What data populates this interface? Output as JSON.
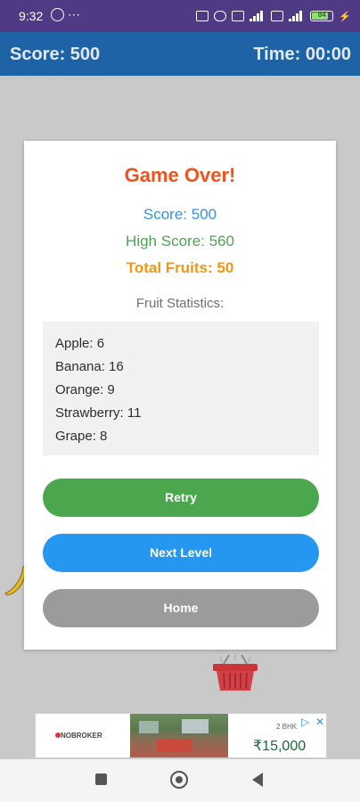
{
  "status_bar": {
    "time": "9:32",
    "dots": "⋯",
    "battery_level": "84",
    "bolt": "⚡"
  },
  "hud": {
    "score": "Score: 500",
    "time": "Time: 00:00"
  },
  "dialog": {
    "title": "Game Over!",
    "score_line": "Score: 500",
    "high_score_line": "High Score: 560",
    "total_fruits_line": "Total Fruits: 50",
    "stats_title": "Fruit Statistics:",
    "fruit_stats": [
      "Apple: 6",
      "Banana: 16",
      "Orange: 9",
      "Strawberry: 11",
      "Grape: 8"
    ],
    "buttons": {
      "retry": "Retry",
      "next_level": "Next Level",
      "home": "Home"
    }
  },
  "ad": {
    "brand": "NOBROKER",
    "small_text": "2 BHK",
    "price": "₹15,000",
    "play_icon": "▷",
    "close_icon": "✕"
  },
  "colors": {
    "status_bar": "#4f3a86",
    "top_bar": "#1d63a6",
    "title": "#f0531c",
    "score": "#2f93e6",
    "high_score": "#4aa650",
    "total_fruits": "#f39712",
    "retry": "#4aa74d",
    "next_level": "#2597f0",
    "home": "#9b9b9b"
  },
  "icons": {
    "whatsapp": "whatsapp-icon",
    "banana": "banana-icon",
    "basket": "basket-icon",
    "nav_recents": "square-icon",
    "nav_home": "circle-icon",
    "nav_back": "back-triangle-icon"
  }
}
